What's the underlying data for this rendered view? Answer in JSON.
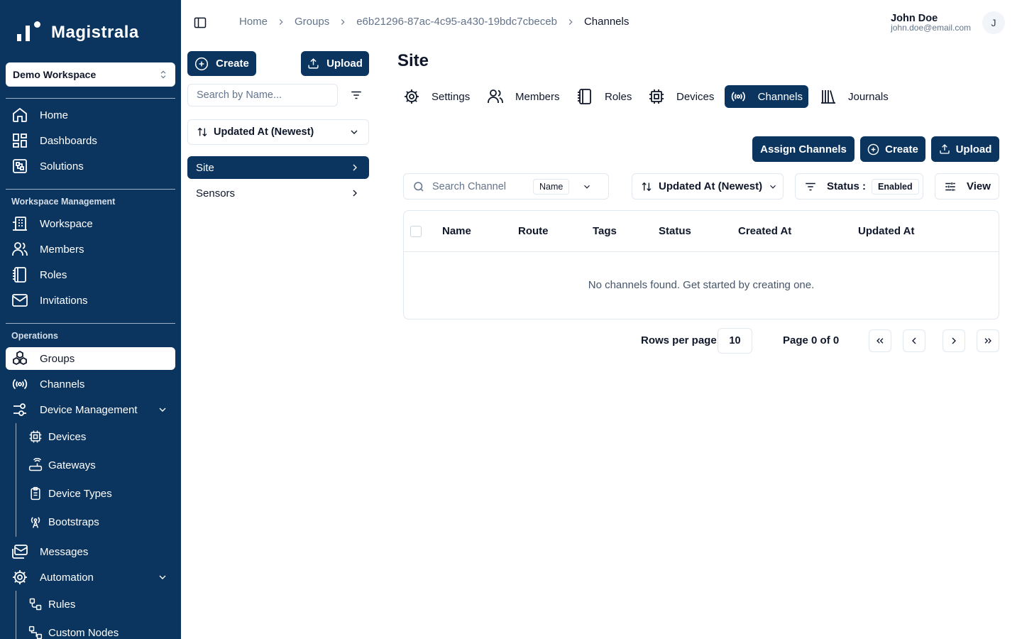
{
  "app": {
    "name": "Magistrala"
  },
  "colors": {
    "brand": "#0b355f",
    "border": "#e2e8f0",
    "muted": "#64748b"
  },
  "workspace": {
    "selected": "Demo Workspace"
  },
  "sidebar": {
    "main": [
      {
        "label": "Home",
        "icon": "home-icon"
      },
      {
        "label": "Dashboards",
        "icon": "dashboard-icon"
      },
      {
        "label": "Solutions",
        "icon": "solutions-icon"
      }
    ],
    "workspace_section": "Workspace Management",
    "workspace_items": [
      {
        "label": "Workspace",
        "icon": "building-icon"
      },
      {
        "label": "Members",
        "icon": "users-icon"
      },
      {
        "label": "Roles",
        "icon": "notebook-icon"
      },
      {
        "label": "Invitations",
        "icon": "mail-icon"
      }
    ],
    "operations_section": "Operations",
    "operations_items": [
      {
        "label": "Groups",
        "icon": "groups-icon",
        "active": true
      },
      {
        "label": "Channels",
        "icon": "radio-icon"
      },
      {
        "label": "Device Management",
        "icon": "device-management-icon",
        "expanded": true
      }
    ],
    "device_sub": [
      {
        "label": "Devices",
        "icon": "cpu-icon"
      },
      {
        "label": "Gateways",
        "icon": "router-icon"
      },
      {
        "label": "Device Types",
        "icon": "clipboard-icon"
      },
      {
        "label": "Bootstraps",
        "icon": "antenna-icon"
      }
    ],
    "more_items": [
      {
        "label": "Messages",
        "icon": "message-icon"
      },
      {
        "label": "Automation",
        "icon": "automation-icon",
        "expanded": true
      }
    ],
    "automation_sub": [
      {
        "label": "Rules",
        "icon": "rules-icon"
      },
      {
        "label": "Custom Nodes",
        "icon": "custom-nodes-icon"
      }
    ]
  },
  "breadcrumb": [
    "Home",
    "Groups",
    "e6b21296-87ac-4c95-a430-19bdc7cbeceb",
    "Channels"
  ],
  "user": {
    "name": "John Doe",
    "email": "john.doe@email.com",
    "initial": "J"
  },
  "groups_panel": {
    "create_label": "Create",
    "upload_label": "Upload",
    "search_placeholder": "Search by Name...",
    "sort_label": "Updated At (Newest)",
    "items": [
      {
        "label": "Site",
        "active": true
      },
      {
        "label": "Sensors",
        "active": false
      }
    ]
  },
  "page": {
    "title": "Site",
    "tabs": [
      {
        "label": "Settings",
        "icon": "settings-icon"
      },
      {
        "label": "Members",
        "icon": "users-icon"
      },
      {
        "label": "Roles",
        "icon": "notebook-icon"
      },
      {
        "label": "Devices",
        "icon": "cpu-icon"
      },
      {
        "label": "Channels",
        "icon": "radio-icon",
        "active": true
      },
      {
        "label": "Journals",
        "icon": "library-icon"
      }
    ],
    "actions": {
      "assign": "Assign Channels",
      "create": "Create",
      "upload": "Upload"
    },
    "filters": {
      "search_placeholder": "Search Channel",
      "search_field": "Name",
      "sort": "Updated At (Newest)",
      "status_label": "Status :",
      "status_value": "Enabled",
      "view": "View"
    },
    "table": {
      "columns": [
        "Name",
        "Route",
        "Tags",
        "Status",
        "Created At",
        "Updated At"
      ],
      "empty": "No channels found. Get started by creating one."
    },
    "pagination": {
      "rows_label": "Rows per page",
      "rows_value": "10",
      "page_text": "Page 0 of 0"
    }
  }
}
